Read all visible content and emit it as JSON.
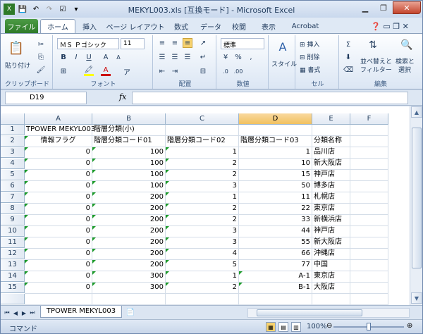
{
  "window": {
    "title": "MEKYL003.xls  [互換モード] - Microsoft Excel"
  },
  "tabs": [
    "ファイル",
    "ホーム",
    "挿入",
    "ページ レイアウト",
    "数式",
    "データ",
    "校閲",
    "表示",
    "Acrobat"
  ],
  "ribbon": {
    "paste": "貼り付け",
    "clipboard": "クリップボード",
    "font_name": "ＭＳ Ｐゴシック",
    "font_size": "11",
    "font_group": "フォント",
    "align_group": "配置",
    "number_format": "標準",
    "number_group": "数値",
    "style": "スタイル",
    "insert": "挿入",
    "delete": "削除",
    "format": "書式",
    "cell_group": "セル",
    "sort_filter": "並べ替えと",
    "sort_filter2": "フィルター",
    "find_select": "検索と",
    "find_select2": "選択",
    "edit_group": "編集"
  },
  "formula_bar": {
    "name_box": "D19",
    "fx": "fx",
    "content": ""
  },
  "columns": [
    "A",
    "B",
    "C",
    "D",
    "E",
    "F"
  ],
  "rows": [
    [
      "TPOWER MEKYL003",
      "階層分類(小)",
      "",
      "",
      "",
      ""
    ],
    [
      "情報フラグ",
      "階層分類コード01",
      "階層分類コード02",
      "階層分類コード03",
      "分類名称",
      ""
    ],
    [
      "0",
      "100",
      "1",
      "1",
      "品川店",
      ""
    ],
    [
      "0",
      "100",
      "2",
      "10",
      "新大阪店",
      ""
    ],
    [
      "0",
      "100",
      "2",
      "15",
      "神戸店",
      ""
    ],
    [
      "0",
      "100",
      "3",
      "50",
      "博多店",
      ""
    ],
    [
      "0",
      "200",
      "1",
      "11",
      "札幌店",
      ""
    ],
    [
      "0",
      "200",
      "2",
      "22",
      "東京店",
      ""
    ],
    [
      "0",
      "200",
      "2",
      "33",
      "新横浜店",
      ""
    ],
    [
      "0",
      "200",
      "3",
      "44",
      "神戸店",
      ""
    ],
    [
      "0",
      "200",
      "3",
      "55",
      "新大阪店",
      ""
    ],
    [
      "0",
      "200",
      "4",
      "66",
      "沖縄店",
      ""
    ],
    [
      "0",
      "200",
      "5",
      "77",
      "中国",
      ""
    ],
    [
      "0",
      "300",
      "1",
      "A-1",
      "東京店",
      ""
    ],
    [
      "0",
      "300",
      "2",
      "B-1",
      "大阪店",
      ""
    ]
  ],
  "row_numbers": [
    "1",
    "2",
    "3",
    "4",
    "5",
    "6",
    "7",
    "8",
    "9",
    "10",
    "11",
    "12",
    "13",
    "14",
    "15"
  ],
  "sheet_tab": "TPOWER MEKYL003",
  "status": {
    "mode": "コマンド",
    "zoom": "100%"
  }
}
